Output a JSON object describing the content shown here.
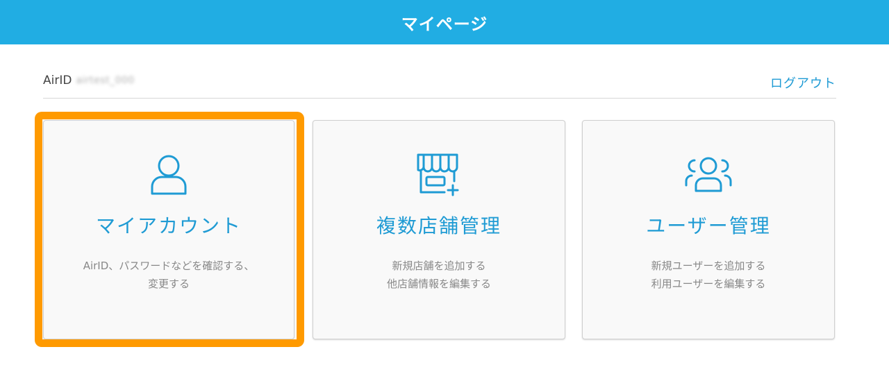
{
  "header": {
    "title": "マイページ"
  },
  "account": {
    "airid_label": "AirID",
    "airid_value": "airtest_000",
    "logout_label": "ログアウト"
  },
  "cards": [
    {
      "title": "マイアカウント",
      "desc_lines": [
        "AirID、パスワードなどを確認する、",
        "変更する"
      ],
      "icon": "user-icon"
    },
    {
      "title": "複数店舗管理",
      "desc_lines": [
        "新規店舗を追加する",
        "他店舗情報を編集する"
      ],
      "icon": "store-add-icon"
    },
    {
      "title": "ユーザー管理",
      "desc_lines": [
        "新規ユーザーを追加する",
        "利用ユーザーを編集する"
      ],
      "icon": "users-icon"
    }
  ],
  "colors": {
    "header_bg": "#21ade3",
    "accent": "#1f9bd4",
    "highlight": "#ff9a00"
  }
}
